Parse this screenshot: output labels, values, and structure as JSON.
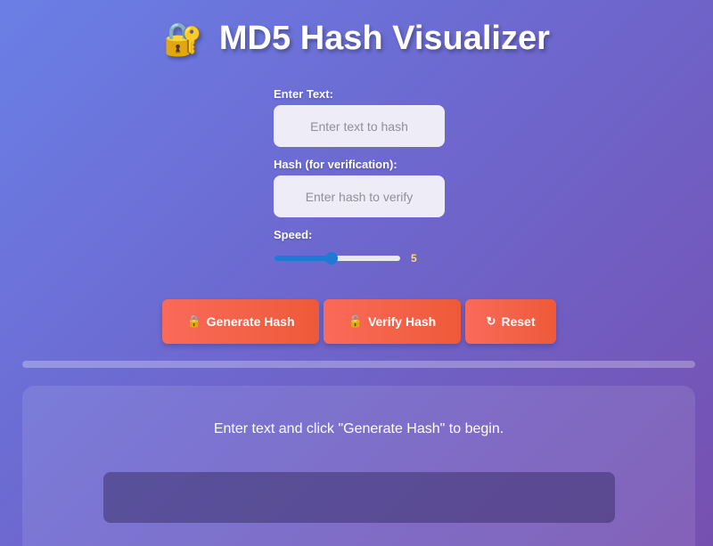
{
  "header": {
    "icon": "lock-with-key-icon",
    "icon_glyph": "🔐",
    "title": "MD5 Hash Visualizer"
  },
  "form": {
    "text_label": "Enter Text:",
    "text_value": "",
    "text_placeholder": "Enter text to hash",
    "hash_label": "Hash (for verification):",
    "hash_value": "",
    "hash_placeholder": "Enter hash to verify",
    "speed_label": "Speed:",
    "speed_value": "5",
    "speed_min": 1,
    "speed_max": 10
  },
  "buttons": {
    "generate_icon": "🔒",
    "generate_label": "Generate Hash",
    "verify_icon": "🔓",
    "verify_label": "Verify Hash",
    "reset_icon": "↻",
    "reset_label": "Reset"
  },
  "progress": {
    "percent": 0
  },
  "output": {
    "message": "Enter text and click \"Generate Hash\" to begin.",
    "hash_result": ""
  },
  "colors": {
    "bg_start": "#6a7fe6",
    "bg_end": "#7650b0",
    "button_accent": "#f06449",
    "slider_accent": "#1f7ad6",
    "speed_value": "#f5e063"
  }
}
